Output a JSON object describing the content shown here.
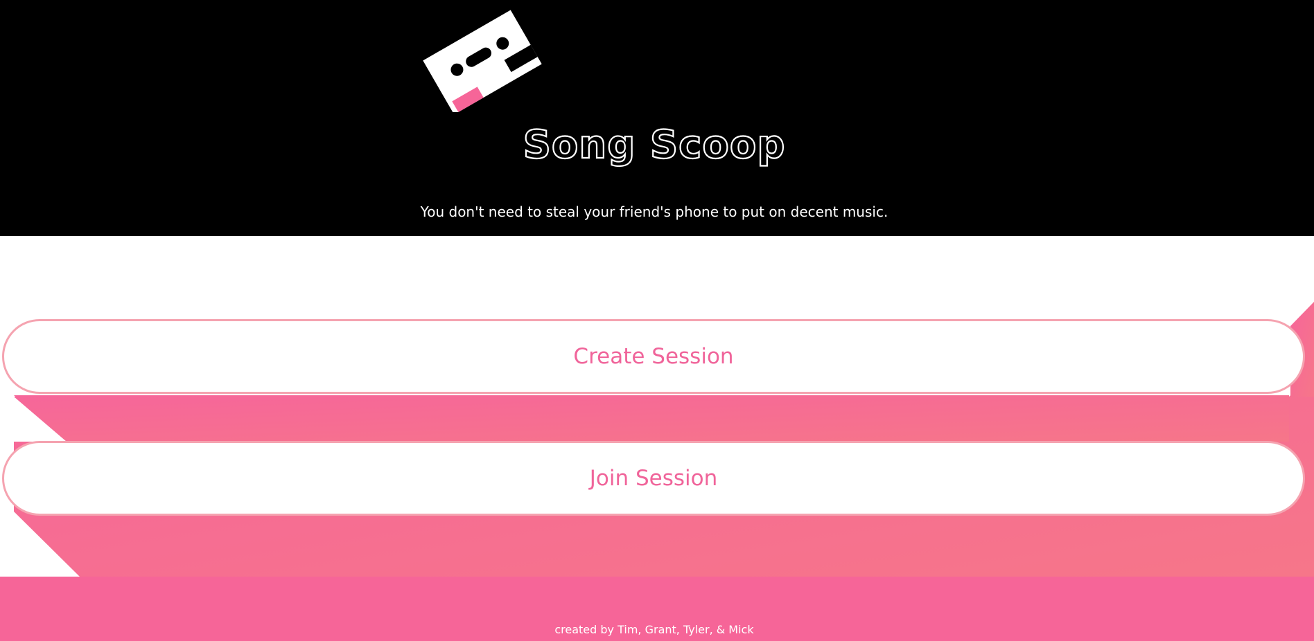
{
  "header": {
    "title": "Song Scoop",
    "tagline": "You don't need to steal your friend's phone to put on decent music."
  },
  "logo": {
    "icon": "cassette-tape-icon",
    "colors": {
      "body": "#ffffff",
      "holes": "#000000",
      "accent": "#f66598"
    }
  },
  "actions": {
    "create_label": "Create Session",
    "join_label": "Join Session"
  },
  "footer": {
    "credits": "created by Tim, Grant, Tyler, & Mick"
  },
  "theme": {
    "header_bg": "#000000",
    "accent_pink": "#f66598",
    "button_text": "#f0649a",
    "button_border": "#f5a3b0",
    "page_bg": "#ffffff"
  }
}
